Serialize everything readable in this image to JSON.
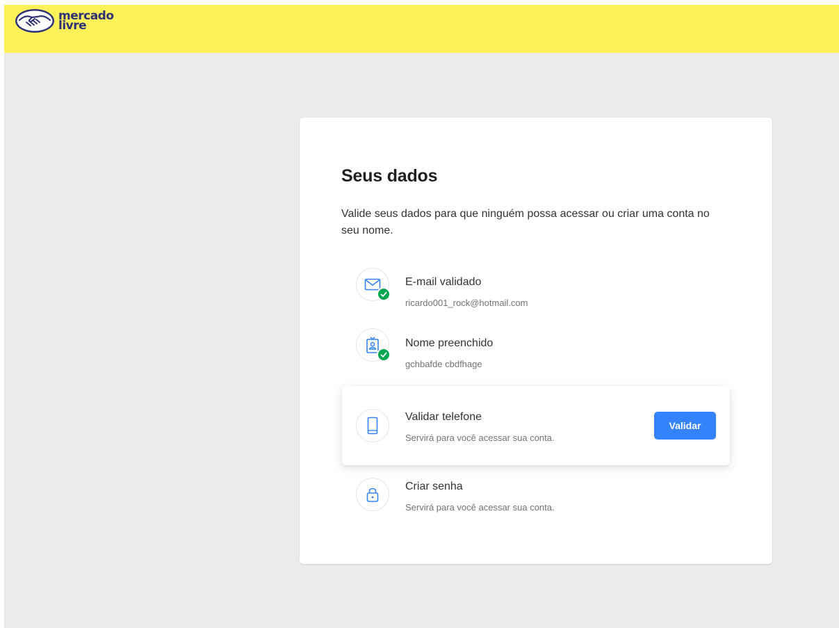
{
  "header": {
    "logo_line1": "mercado",
    "logo_line2": "livre",
    "brand_color": "#fff159",
    "logo_text_color": "#2d3277"
  },
  "page": {
    "title": "Seus dados",
    "description": "Valide seus dados para que ninguém possa acessar ou criar uma conta no seu nome."
  },
  "steps": [
    {
      "icon": "mail-icon",
      "title": "E-mail validado",
      "subtitle": "ricardo001_rock@hotmail.com",
      "status": "completed"
    },
    {
      "icon": "id-badge-icon",
      "title": "Nome preenchido",
      "subtitle": "gchbafde cbdfhage",
      "status": "completed"
    },
    {
      "icon": "phone-icon",
      "title": "Validar telefone",
      "subtitle": "Servirá para você acessar sua conta.",
      "status": "active",
      "button_label": "Validar"
    },
    {
      "icon": "lock-icon",
      "title": "Criar senha",
      "subtitle": "Servirá para você acessar sua conta.",
      "status": "pending"
    }
  ],
  "colors": {
    "accent": "#3483fa",
    "success": "#00a650",
    "background": "#ebebeb"
  }
}
